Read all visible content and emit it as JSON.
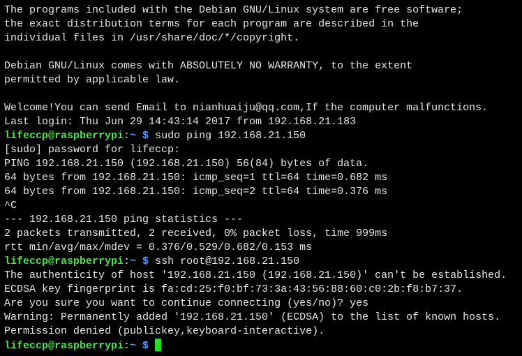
{
  "terminal": {
    "colors": {
      "background": "#000000",
      "text": "#e6e6e6",
      "user_host": "#4fe04f",
      "path_prompt": "#5a9cff",
      "cursor": "#22e022"
    },
    "lines": [
      {
        "type": "text",
        "text": "The programs included with the Debian GNU/Linux system are free software;"
      },
      {
        "type": "text",
        "text": "the exact distribution terms for each program are described in the"
      },
      {
        "type": "text",
        "text": "individual files in /usr/share/doc/*/copyright."
      },
      {
        "type": "text",
        "text": ""
      },
      {
        "type": "text",
        "text": "Debian GNU/Linux comes with ABSOLUTELY NO WARRANTY, to the extent"
      },
      {
        "type": "text",
        "text": "permitted by applicable law."
      },
      {
        "type": "text",
        "text": ""
      },
      {
        "type": "text",
        "text": "Welcome!You can send Email to nianhuaiju@qq.com,If the computer malfunctions."
      },
      {
        "type": "text",
        "text": "Last login: Thu Jun 29 14:43:14 2017 from 192.168.21.183"
      },
      {
        "type": "prompt",
        "user": "lifeccp@raspberrypi",
        "colon": ":",
        "path": "~ $",
        "cmd": " sudo ping 192.168.21.150"
      },
      {
        "type": "text",
        "text": "[sudo] password for lifeccp:"
      },
      {
        "type": "text",
        "text": "PING 192.168.21.150 (192.168.21.150) 56(84) bytes of data."
      },
      {
        "type": "text",
        "text": "64 bytes from 192.168.21.150: icmp_seq=1 ttl=64 time=0.682 ms"
      },
      {
        "type": "text",
        "text": "64 bytes from 192.168.21.150: icmp_seq=2 ttl=64 time=0.376 ms"
      },
      {
        "type": "text",
        "text": "^C"
      },
      {
        "type": "text",
        "text": "--- 192.168.21.150 ping statistics ---"
      },
      {
        "type": "text",
        "text": "2 packets transmitted, 2 received, 0% packet loss, time 999ms"
      },
      {
        "type": "text",
        "text": "rtt min/avg/max/mdev = 0.376/0.529/0.682/0.153 ms"
      },
      {
        "type": "prompt",
        "user": "lifeccp@raspberrypi",
        "colon": ":",
        "path": "~ $",
        "cmd": " ssh root@192.168.21.150"
      },
      {
        "type": "text",
        "text": "The authenticity of host '192.168.21.150 (192.168.21.150)' can't be established."
      },
      {
        "type": "text",
        "text": "ECDSA key fingerprint is fa:cd:25:f0:bf:73:3a:43:56:88:60:c0:2b:f8:b7:37."
      },
      {
        "type": "text",
        "text": "Are you sure you want to continue connecting (yes/no)? yes"
      },
      {
        "type": "text",
        "text": "Warning: Permanently added '192.168.21.150' (ECDSA) to the list of known hosts."
      },
      {
        "type": "text",
        "text": "Permission denied (publickey,keyboard-interactive)."
      },
      {
        "type": "prompt",
        "user": "lifeccp@raspberrypi",
        "colon": ":",
        "path": "~ $",
        "cmd": " ",
        "cursor": true
      }
    ]
  }
}
